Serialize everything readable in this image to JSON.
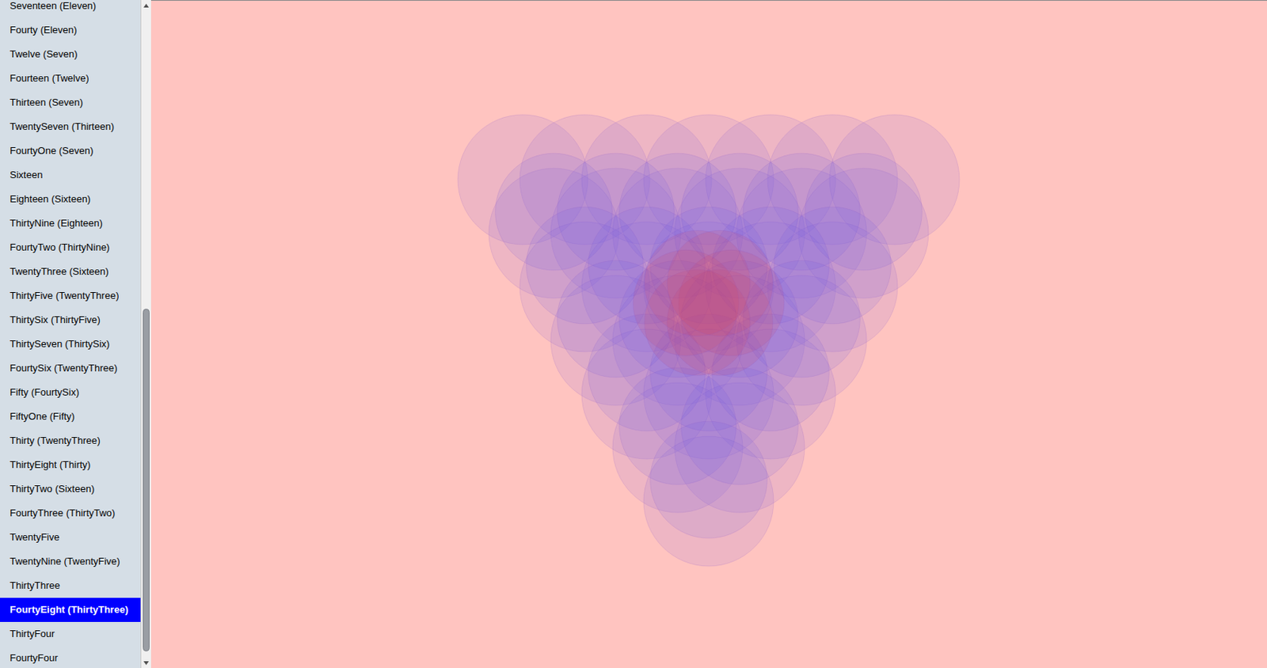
{
  "sidebar": {
    "items": [
      {
        "label": "Seventeen (Eleven)",
        "selected": false
      },
      {
        "label": "Fourty (Eleven)",
        "selected": false
      },
      {
        "label": "Twelve (Seven)",
        "selected": false
      },
      {
        "label": "Fourteen (Twelve)",
        "selected": false
      },
      {
        "label": "Thirteen (Seven)",
        "selected": false
      },
      {
        "label": "TwentySeven (Thirteen)",
        "selected": false
      },
      {
        "label": "FourtyOne (Seven)",
        "selected": false
      },
      {
        "label": "Sixteen",
        "selected": false
      },
      {
        "label": "Eighteen (Sixteen)",
        "selected": false
      },
      {
        "label": "ThirtyNine (Eighteen)",
        "selected": false
      },
      {
        "label": "FourtyTwo (ThirtyNine)",
        "selected": false
      },
      {
        "label": "TwentyThree (Sixteen)",
        "selected": false
      },
      {
        "label": "ThirtyFive (TwentyThree)",
        "selected": false
      },
      {
        "label": "ThirtySix (ThirtyFive)",
        "selected": false
      },
      {
        "label": "ThirtySeven (ThirtySix)",
        "selected": false
      },
      {
        "label": "FourtySix (TwentyThree)",
        "selected": false
      },
      {
        "label": "Fifty (FourtySix)",
        "selected": false
      },
      {
        "label": "FiftyOne (Fifty)",
        "selected": false
      },
      {
        "label": "Thirty (TwentyThree)",
        "selected": false
      },
      {
        "label": "ThirtyEight (Thirty)",
        "selected": false
      },
      {
        "label": "ThirtyTwo (Sixteen)",
        "selected": false
      },
      {
        "label": "FourtyThree (ThirtyTwo)",
        "selected": false
      },
      {
        "label": "TwentyFive",
        "selected": false
      },
      {
        "label": "TwentyNine (TwentyFive)",
        "selected": false
      },
      {
        "label": "ThirtyThree",
        "selected": false
      },
      {
        "label": "FourtyEight (ThirtyThree)",
        "selected": true
      },
      {
        "label": "ThirtyFour",
        "selected": false
      },
      {
        "label": "FourtyFour",
        "selected": false
      }
    ]
  },
  "scrollbar": {
    "level": 0.98,
    "thumb_size": 0.53
  }
}
